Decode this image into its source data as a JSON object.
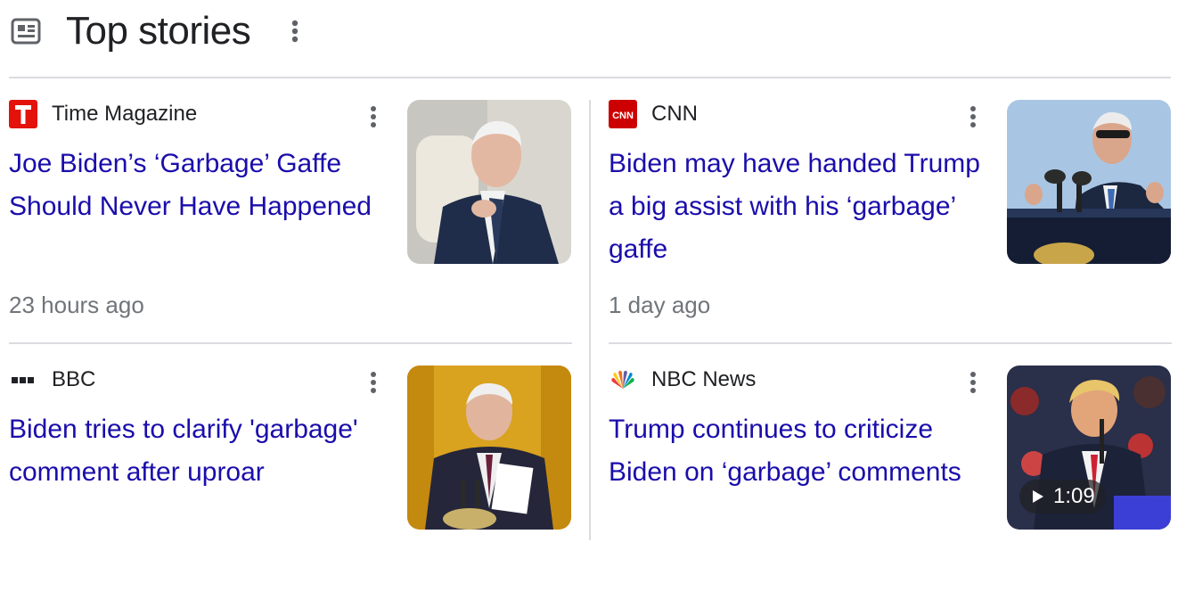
{
  "header": {
    "title": "Top stories"
  },
  "stories": [
    {
      "publisher": "Time Magazine",
      "headline": "Joe Biden’s ‘Garbage’ Gaffe Should Never Have Happened",
      "time": "23 hours ago",
      "logo_color": "#e3120b"
    },
    {
      "publisher": "CNN",
      "headline": "Biden may have handed Trump a big assist with his ‘garbage’ gaffe",
      "time": "1 day ago",
      "logo_color": "#cc0000",
      "logo_text": "CNN"
    },
    {
      "publisher": "BBC",
      "headline": "Biden tries to clarify 'garbage' comment after uproar"
    },
    {
      "publisher": "NBC News",
      "headline": "Trump continues to criticize Biden on ‘garbage’ comments",
      "video_duration": "1:09"
    }
  ],
  "colors": {
    "link": "#1a0dab",
    "text": "#202124",
    "muted": "#70757a",
    "divider": "#dadce0"
  },
  "icons": {
    "section": "newspaper-icon",
    "more": "more-vert-icon",
    "play": "play-icon"
  }
}
